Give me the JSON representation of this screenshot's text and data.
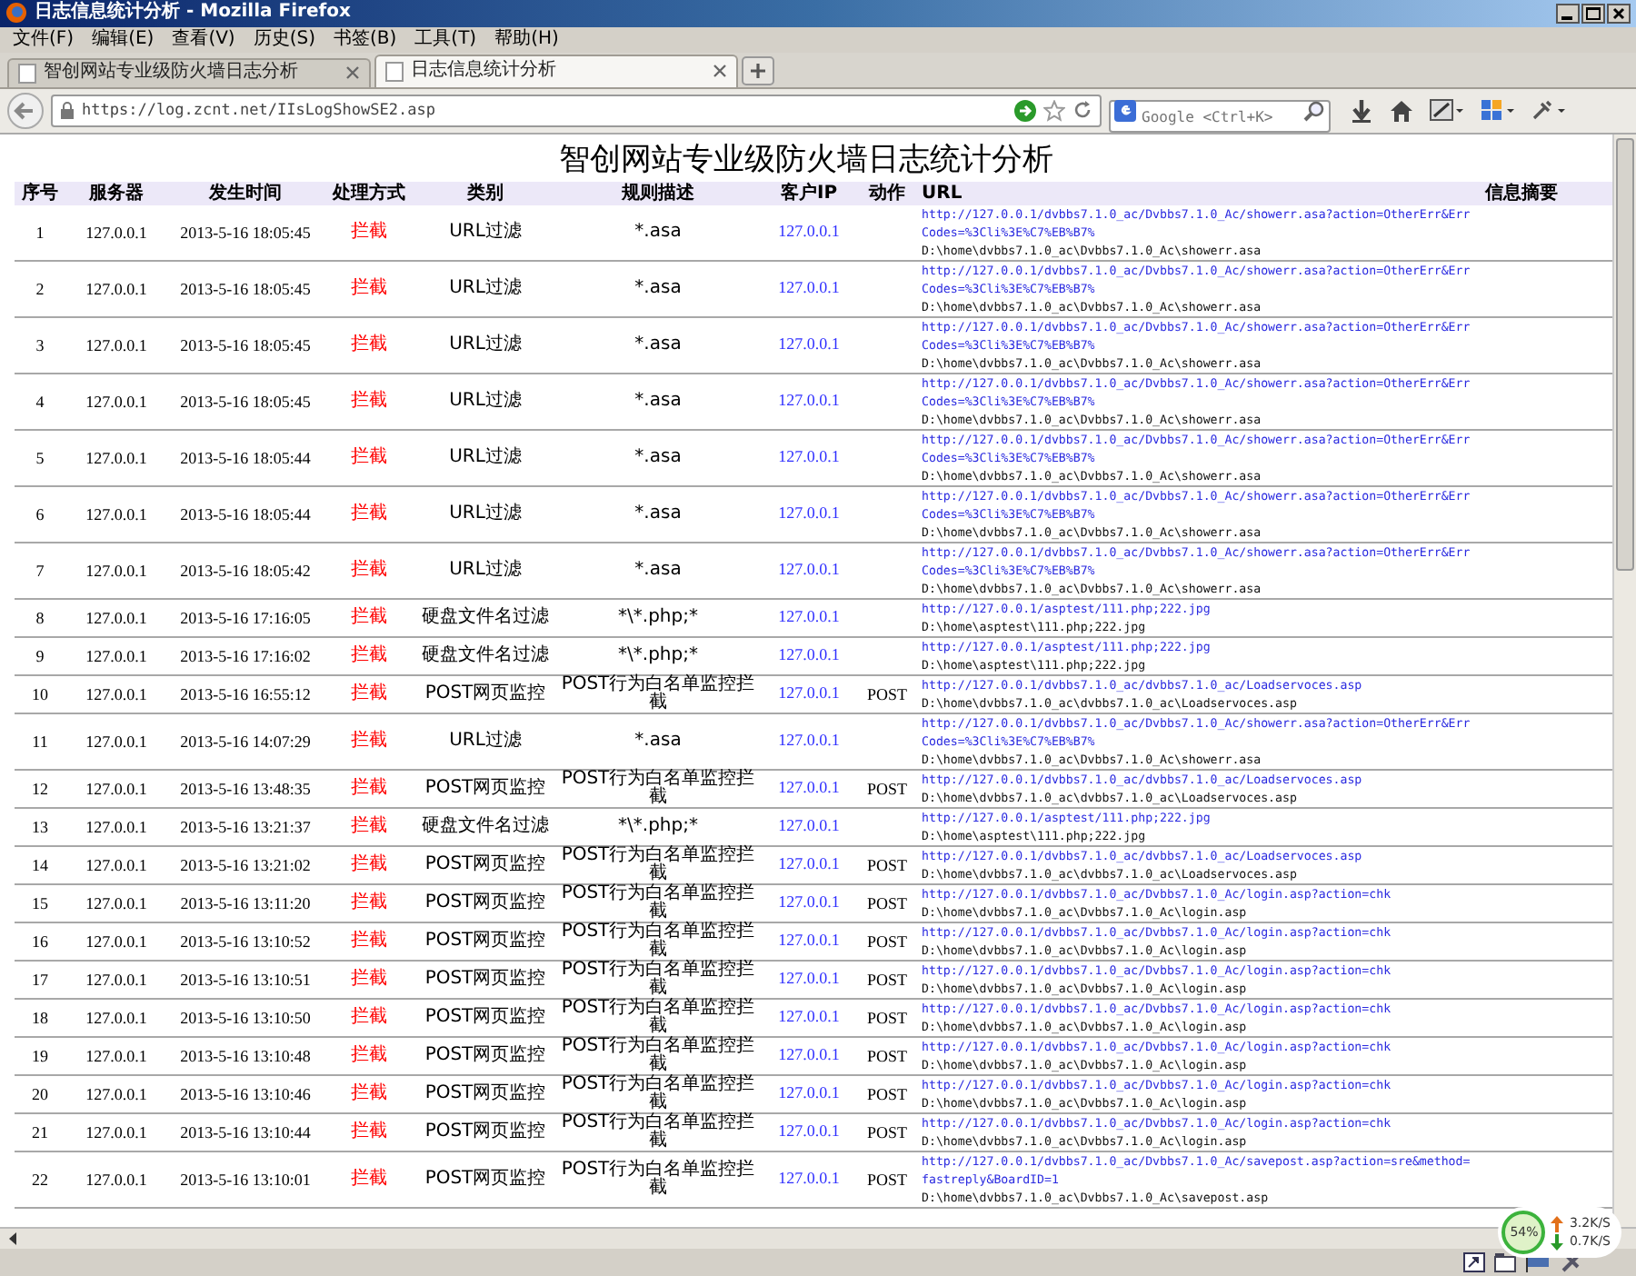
{
  "window": {
    "title": "日志信息统计分析 - Mozilla Firefox"
  },
  "menu": [
    "文件(F)",
    "编辑(E)",
    "查看(V)",
    "历史(S)",
    "书签(B)",
    "工具(T)",
    "帮助(H)"
  ],
  "tabs": [
    {
      "label": "智创网站专业级防火墙日志分析",
      "selected": false
    },
    {
      "label": "日志信息统计分析",
      "selected": true
    }
  ],
  "address": {
    "value": "https://log.zcnt.net/IIsLogShowSE2.asp"
  },
  "search": {
    "placeholder": "Google <Ctrl+K>"
  },
  "page": {
    "title": "智创网站专业级防火墙日志统计分析",
    "columns": [
      "序号",
      "服务器",
      "发生时间",
      "处理方式",
      "类别",
      "规则描述",
      "客户IP",
      "动作",
      "URL",
      "信息摘要"
    ],
    "rows": [
      {
        "no": "1",
        "server": "127.0.0.1",
        "time": "2013-5-16 18:05:45",
        "handling": "拦截",
        "category": "URL过滤",
        "rule": "*.asa",
        "client_ip": "127.0.0.1",
        "url": "http://127.0.0.1/dvbbs7.1.0_ac/Dvbbs7.1.0_Ac/showerr.asa?action=OtherErr&ErrCodes=%3Cli%3E%C7%EB%B7%",
        "path": "D:\\home\\dvbbs7.1.0_ac\\Dvbbs7.1.0_Ac\\showerr.asa"
      },
      {
        "no": "2",
        "server": "127.0.0.1",
        "time": "2013-5-16 18:05:45",
        "handling": "拦截",
        "category": "URL过滤",
        "rule": "*.asa",
        "client_ip": "127.0.0.1",
        "url": "http://127.0.0.1/dvbbs7.1.0_ac/Dvbbs7.1.0_Ac/showerr.asa?action=OtherErr&ErrCodes=%3Cli%3E%C7%EB%B7%",
        "path": "D:\\home\\dvbbs7.1.0_ac\\Dvbbs7.1.0_Ac\\showerr.asa"
      },
      {
        "no": "3",
        "server": "127.0.0.1",
        "time": "2013-5-16 18:05:45",
        "handling": "拦截",
        "category": "URL过滤",
        "rule": "*.asa",
        "client_ip": "127.0.0.1",
        "url": "http://127.0.0.1/dvbbs7.1.0_ac/Dvbbs7.1.0_Ac/showerr.asa?action=OtherErr&ErrCodes=%3Cli%3E%C7%EB%B7%",
        "path": "D:\\home\\dvbbs7.1.0_ac\\Dvbbs7.1.0_Ac\\showerr.asa"
      },
      {
        "no": "4",
        "server": "127.0.0.1",
        "time": "2013-5-16 18:05:45",
        "handling": "拦截",
        "category": "URL过滤",
        "rule": "*.asa",
        "client_ip": "127.0.0.1",
        "url": "http://127.0.0.1/dvbbs7.1.0_ac/Dvbbs7.1.0_Ac/showerr.asa?action=OtherErr&ErrCodes=%3Cli%3E%C7%EB%B7%",
        "path": "D:\\home\\dvbbs7.1.0_ac\\Dvbbs7.1.0_Ac\\showerr.asa"
      },
      {
        "no": "5",
        "server": "127.0.0.1",
        "time": "2013-5-16 18:05:44",
        "handling": "拦截",
        "category": "URL过滤",
        "rule": "*.asa",
        "client_ip": "127.0.0.1",
        "url": "http://127.0.0.1/dvbbs7.1.0_ac/Dvbbs7.1.0_Ac/showerr.asa?action=OtherErr&ErrCodes=%3Cli%3E%C7%EB%B7%",
        "path": "D:\\home\\dvbbs7.1.0_ac\\Dvbbs7.1.0_Ac\\showerr.asa"
      },
      {
        "no": "6",
        "server": "127.0.0.1",
        "time": "2013-5-16 18:05:44",
        "handling": "拦截",
        "category": "URL过滤",
        "rule": "*.asa",
        "client_ip": "127.0.0.1",
        "url": "http://127.0.0.1/dvbbs7.1.0_ac/Dvbbs7.1.0_Ac/showerr.asa?action=OtherErr&ErrCodes=%3Cli%3E%C7%EB%B7%",
        "path": "D:\\home\\dvbbs7.1.0_ac\\Dvbbs7.1.0_Ac\\showerr.asa"
      },
      {
        "no": "7",
        "server": "127.0.0.1",
        "time": "2013-5-16 18:05:42",
        "handling": "拦截",
        "category": "URL过滤",
        "rule": "*.asa",
        "client_ip": "127.0.0.1",
        "url": "http://127.0.0.1/dvbbs7.1.0_ac/Dvbbs7.1.0_Ac/showerr.asa?action=OtherErr&ErrCodes=%3Cli%3E%C7%EB%B7%",
        "path": "D:\\home\\dvbbs7.1.0_ac\\Dvbbs7.1.0_Ac\\showerr.asa"
      },
      {
        "no": "8",
        "server": "127.0.0.1",
        "time": "2013-5-16 17:16:05",
        "handling": "拦截",
        "category": "硬盘文件名过滤",
        "rule": "*\\*.php;*",
        "client_ip": "127.0.0.1",
        "url": "http://127.0.0.1/asptest/111.php;222.jpg",
        "path": "D:\\home\\asptest\\111.php;222.jpg"
      },
      {
        "no": "9",
        "server": "127.0.0.1",
        "time": "2013-5-16 17:16:02",
        "handling": "拦截",
        "category": "硬盘文件名过滤",
        "rule": "*\\*.php;*",
        "client_ip": "127.0.0.1",
        "url": "http://127.0.0.1/asptest/111.php;222.jpg",
        "path": "D:\\home\\asptest\\111.php;222.jpg"
      },
      {
        "no": "10",
        "server": "127.0.0.1",
        "time": "2013-5-16 16:55:12",
        "handling": "拦截",
        "category": "POST网页监控",
        "rule": "POST行为白名单监控拦截",
        "client_ip": "127.0.0.1",
        "method": "POST",
        "url": "http://127.0.0.1/dvbbs7.1.0_ac/dvbbs7.1.0_ac/Loadservoces.asp",
        "path": "D:\\home\\dvbbs7.1.0_ac\\dvbbs7.1.0_ac\\Loadservoces.asp"
      },
      {
        "no": "11",
        "server": "127.0.0.1",
        "time": "2013-5-16 14:07:29",
        "handling": "拦截",
        "category": "URL过滤",
        "rule": "*.asa",
        "client_ip": "127.0.0.1",
        "url": "http://127.0.0.1/dvbbs7.1.0_ac/Dvbbs7.1.0_Ac/showerr.asa?action=OtherErr&ErrCodes=%3Cli%3E%C7%EB%B7%",
        "path": "D:\\home\\dvbbs7.1.0_ac\\Dvbbs7.1.0_Ac\\showerr.asa"
      },
      {
        "no": "12",
        "server": "127.0.0.1",
        "time": "2013-5-16 13:48:35",
        "handling": "拦截",
        "category": "POST网页监控",
        "rule": "POST行为白名单监控拦截",
        "client_ip": "127.0.0.1",
        "method": "POST",
        "url": "http://127.0.0.1/dvbbs7.1.0_ac/dvbbs7.1.0_ac/Loadservoces.asp",
        "path": "D:\\home\\dvbbs7.1.0_ac\\dvbbs7.1.0_ac\\Loadservoces.asp"
      },
      {
        "no": "13",
        "server": "127.0.0.1",
        "time": "2013-5-16 13:21:37",
        "handling": "拦截",
        "category": "硬盘文件名过滤",
        "rule": "*\\*.php;*",
        "client_ip": "127.0.0.1",
        "url": "http://127.0.0.1/asptest/111.php;222.jpg",
        "path": "D:\\home\\asptest\\111.php;222.jpg"
      },
      {
        "no": "14",
        "server": "127.0.0.1",
        "time": "2013-5-16 13:21:02",
        "handling": "拦截",
        "category": "POST网页监控",
        "rule": "POST行为白名单监控拦截",
        "client_ip": "127.0.0.1",
        "method": "POST",
        "url": "http://127.0.0.1/dvbbs7.1.0_ac/dvbbs7.1.0_ac/Loadservoces.asp",
        "path": "D:\\home\\dvbbs7.1.0_ac\\dvbbs7.1.0_ac\\Loadservoces.asp"
      },
      {
        "no": "15",
        "server": "127.0.0.1",
        "time": "2013-5-16 13:11:20",
        "handling": "拦截",
        "category": "POST网页监控",
        "rule": "POST行为白名单监控拦截",
        "client_ip": "127.0.0.1",
        "method": "POST",
        "url": "http://127.0.0.1/dvbbs7.1.0_ac/Dvbbs7.1.0_Ac/login.asp?action=chk",
        "path": "D:\\home\\dvbbs7.1.0_ac\\Dvbbs7.1.0_Ac\\login.asp"
      },
      {
        "no": "16",
        "server": "127.0.0.1",
        "time": "2013-5-16 13:10:52",
        "handling": "拦截",
        "category": "POST网页监控",
        "rule": "POST行为白名单监控拦截",
        "client_ip": "127.0.0.1",
        "method": "POST",
        "url": "http://127.0.0.1/dvbbs7.1.0_ac/Dvbbs7.1.0_Ac/login.asp?action=chk",
        "path": "D:\\home\\dvbbs7.1.0_ac\\Dvbbs7.1.0_Ac\\login.asp"
      },
      {
        "no": "17",
        "server": "127.0.0.1",
        "time": "2013-5-16 13:10:51",
        "handling": "拦截",
        "category": "POST网页监控",
        "rule": "POST行为白名单监控拦截",
        "client_ip": "127.0.0.1",
        "method": "POST",
        "url": "http://127.0.0.1/dvbbs7.1.0_ac/Dvbbs7.1.0_Ac/login.asp?action=chk",
        "path": "D:\\home\\dvbbs7.1.0_ac\\Dvbbs7.1.0_Ac\\login.asp"
      },
      {
        "no": "18",
        "server": "127.0.0.1",
        "time": "2013-5-16 13:10:50",
        "handling": "拦截",
        "category": "POST网页监控",
        "rule": "POST行为白名单监控拦截",
        "client_ip": "127.0.0.1",
        "method": "POST",
        "url": "http://127.0.0.1/dvbbs7.1.0_ac/Dvbbs7.1.0_Ac/login.asp?action=chk",
        "path": "D:\\home\\dvbbs7.1.0_ac\\Dvbbs7.1.0_Ac\\login.asp"
      },
      {
        "no": "19",
        "server": "127.0.0.1",
        "time": "2013-5-16 13:10:48",
        "handling": "拦截",
        "category": "POST网页监控",
        "rule": "POST行为白名单监控拦截",
        "client_ip": "127.0.0.1",
        "method": "POST",
        "url": "http://127.0.0.1/dvbbs7.1.0_ac/Dvbbs7.1.0_Ac/login.asp?action=chk",
        "path": "D:\\home\\dvbbs7.1.0_ac\\Dvbbs7.1.0_Ac\\login.asp"
      },
      {
        "no": "20",
        "server": "127.0.0.1",
        "time": "2013-5-16 13:10:46",
        "handling": "拦截",
        "category": "POST网页监控",
        "rule": "POST行为白名单监控拦截",
        "client_ip": "127.0.0.1",
        "method": "POST",
        "url": "http://127.0.0.1/dvbbs7.1.0_ac/Dvbbs7.1.0_Ac/login.asp?action=chk",
        "path": "D:\\home\\dvbbs7.1.0_ac\\Dvbbs7.1.0_Ac\\login.asp"
      },
      {
        "no": "21",
        "server": "127.0.0.1",
        "time": "2013-5-16 13:10:44",
        "handling": "拦截",
        "category": "POST网页监控",
        "rule": "POST行为白名单监控拦截",
        "client_ip": "127.0.0.1",
        "method": "POST",
        "url": "http://127.0.0.1/dvbbs7.1.0_ac/Dvbbs7.1.0_Ac/login.asp?action=chk",
        "path": "D:\\home\\dvbbs7.1.0_ac\\Dvbbs7.1.0_Ac\\login.asp"
      },
      {
        "no": "22",
        "server": "127.0.0.1",
        "time": "2013-5-16 13:10:01",
        "handling": "拦截",
        "category": "POST网页监控",
        "rule": "POST行为白名单监控拦截",
        "client_ip": "127.0.0.1",
        "method": "POST",
        "url": "http://127.0.0.1/dvbbs7.1.0_ac/Dvbbs7.1.0_Ac/savepost.asp?action=sre&method=fastreply&BoardID=1",
        "path": "D:\\home\\dvbbs7.1.0_ac\\Dvbbs7.1.0_Ac\\savepost.asp"
      }
    ]
  },
  "network_meter": {
    "percent": "54%",
    "upload": "3.2K/S",
    "download": "0.7K/S"
  }
}
